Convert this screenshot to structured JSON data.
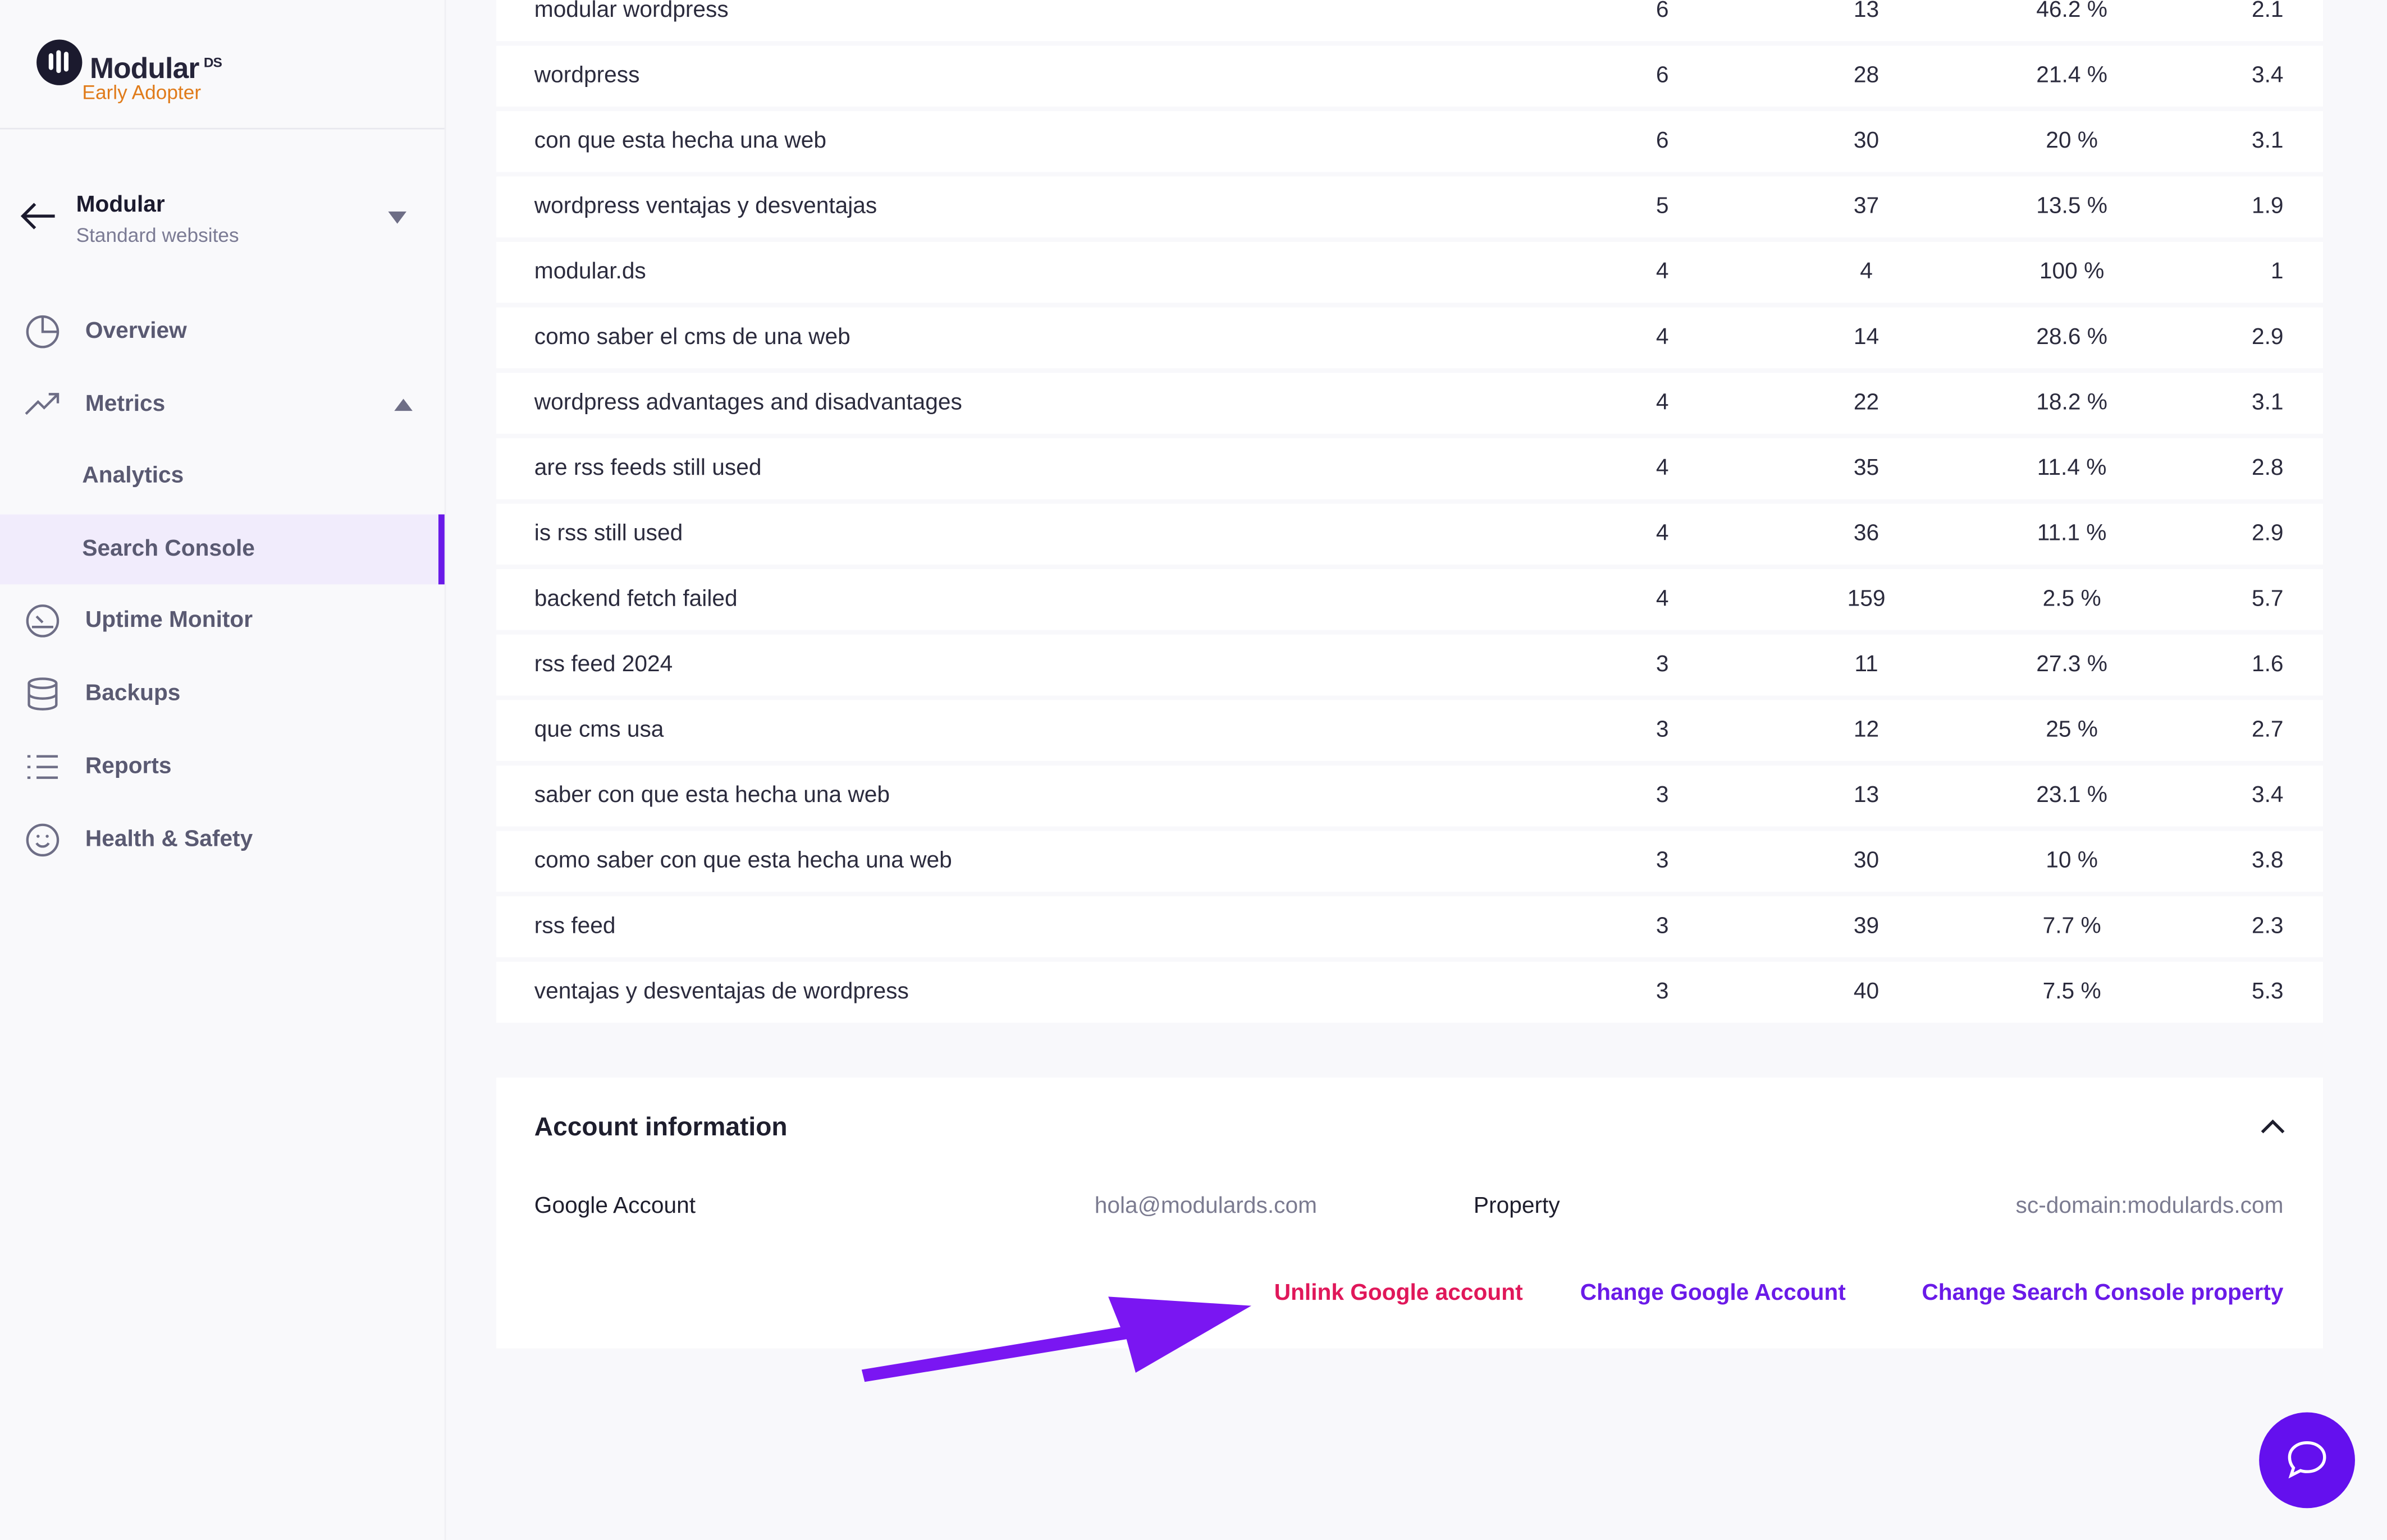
{
  "brand": {
    "name": "Modular",
    "suffix": "DS",
    "tier": "Early Adopter",
    "tier_color": "#e07b1a"
  },
  "site": {
    "name": "Modular",
    "type": "Standard websites"
  },
  "nav": [
    {
      "label": "Overview",
      "icon": "pie-chart-icon"
    },
    {
      "label": "Metrics",
      "icon": "trending-up-icon",
      "expanded": true
    },
    {
      "label": "Analytics",
      "sub": true
    },
    {
      "label": "Search Console",
      "sub": true,
      "active": true
    },
    {
      "label": "Uptime Monitor",
      "icon": "gauge-icon"
    },
    {
      "label": "Backups",
      "icon": "database-icon"
    },
    {
      "label": "Reports",
      "icon": "list-icon"
    },
    {
      "label": "Health & Safety",
      "icon": "smile-icon"
    }
  ],
  "table": {
    "rows": [
      [
        "modular wordpress",
        "6",
        "13",
        "46.2 %",
        "2.1"
      ],
      [
        "wordpress",
        "6",
        "28",
        "21.4 %",
        "3.4"
      ],
      [
        "con que esta hecha una web",
        "6",
        "30",
        "20 %",
        "3.1"
      ],
      [
        "wordpress ventajas y desventajas",
        "5",
        "37",
        "13.5 %",
        "1.9"
      ],
      [
        "modular.ds",
        "4",
        "4",
        "100 %",
        "1"
      ],
      [
        "como saber el cms de una web",
        "4",
        "14",
        "28.6 %",
        "2.9"
      ],
      [
        "wordpress advantages and disadvantages",
        "4",
        "22",
        "18.2 %",
        "3.1"
      ],
      [
        "are rss feeds still used",
        "4",
        "35",
        "11.4 %",
        "2.8"
      ],
      [
        "is rss still used",
        "4",
        "36",
        "11.1 %",
        "2.9"
      ],
      [
        "backend fetch failed",
        "4",
        "159",
        "2.5 %",
        "5.7"
      ],
      [
        "rss feed 2024",
        "3",
        "11",
        "27.3 %",
        "1.6"
      ],
      [
        "que cms usa",
        "3",
        "12",
        "25 %",
        "2.7"
      ],
      [
        "saber con que esta hecha una web",
        "3",
        "13",
        "23.1 %",
        "3.4"
      ],
      [
        "como saber con que esta hecha una web",
        "3",
        "30",
        "10 %",
        "3.8"
      ],
      [
        "rss feed",
        "3",
        "39",
        "7.7 %",
        "2.3"
      ],
      [
        "ventajas y desventajas de wordpress",
        "3",
        "40",
        "7.5 %",
        "5.3"
      ]
    ]
  },
  "account": {
    "title": "Account information",
    "google_label": "Google Account",
    "google_value": "hola@modulards.com",
    "property_label": "Property",
    "property_value": "sc-domain:modulards.com",
    "unlink": "Unlink Google account",
    "change_account": "Change Google Account",
    "change_property": "Change Search Console property",
    "danger_color": "#e0175a",
    "accent_color": "#6a1ae8"
  }
}
